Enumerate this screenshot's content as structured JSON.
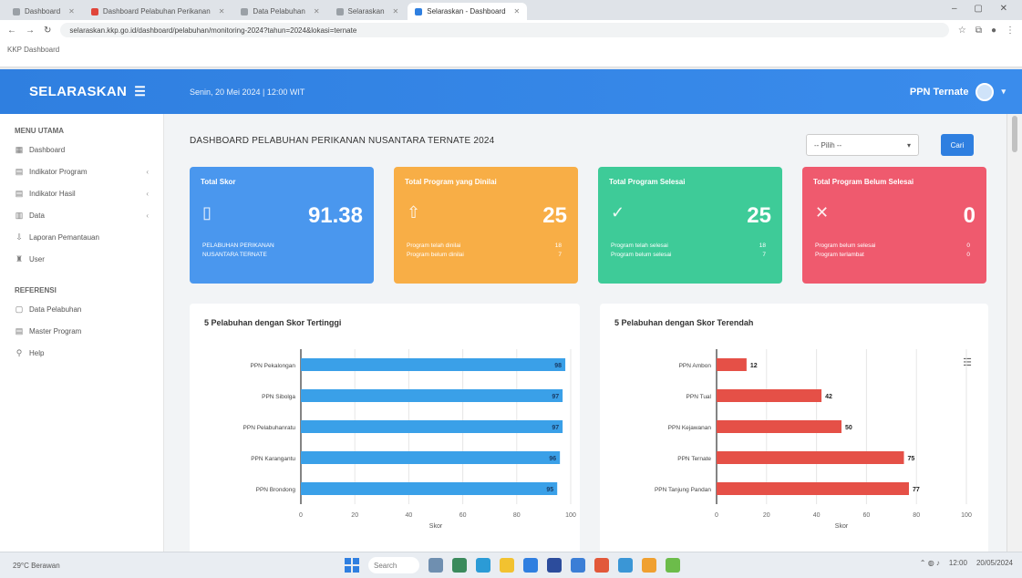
{
  "browser": {
    "tabs": [
      {
        "label": "Dashboard",
        "active": false
      },
      {
        "label": "Dashboard Pelabuhan Perikanan",
        "active": false
      },
      {
        "label": "Data Pelabuhan",
        "active": false
      },
      {
        "label": "Selaraskan",
        "active": false
      },
      {
        "label": "Selaraskan - Dashboard",
        "active": true
      }
    ],
    "url": "selaraskan.kkp.go.id/dashboard/pelabuhan/monitoring-2024?tahun=2024&lokasi=ternate",
    "bookmarks": "KKP   Dashboard"
  },
  "header": {
    "brand": "SELARASKAN",
    "info": "Senin, 20 Mei 2024  |  12:00 WIT",
    "user": "PPN Ternate"
  },
  "sidebar": {
    "section1": "MENU UTAMA",
    "items": [
      {
        "icon": "▦",
        "label": "Dashboard",
        "has_arrow": false
      },
      {
        "icon": "▤",
        "label": "Indikator Program",
        "has_arrow": true
      },
      {
        "icon": "▤",
        "label": "Indikator Hasil",
        "has_arrow": true
      },
      {
        "icon": "▥",
        "label": "Data",
        "has_arrow": true
      },
      {
        "icon": "⇩",
        "label": "Laporan Pemantauan",
        "has_arrow": false
      },
      {
        "icon": "♜",
        "label": "User",
        "has_arrow": false
      }
    ],
    "section2": "REFERENSI",
    "items2": [
      {
        "icon": "▢",
        "label": "Data Pelabuhan"
      },
      {
        "icon": "▤",
        "label": "Master Program"
      },
      {
        "icon": "⚲",
        "label": "Help"
      }
    ]
  },
  "dashboard": {
    "title": "DASHBOARD PELABUHAN PERIKANAN NUSANTARA TERNATE 2024",
    "year_select": "-- Pilih --",
    "filter_label": "Cari"
  },
  "cards": [
    {
      "title": "Total Skor",
      "icon": "▯",
      "value": "91.38",
      "sub1": "PELABUHAN PERIKANAN",
      "sub2": "NUSANTARA TERNATE",
      "sub1_val": "",
      "sub2_val": "",
      "color": "#4a97ee"
    },
    {
      "title": "Total Program yang Dinilai",
      "icon": "⇧",
      "value": "25",
      "sub1": "Program telah dinilai",
      "sub2": "Program belum dinilai",
      "sub1_val": "18",
      "sub2_val": "7",
      "color": "#f8ae46"
    },
    {
      "title": "Total Program Selesai",
      "icon": "✓",
      "value": "25",
      "sub1": "Program telah selesai",
      "sub2": "Program belum selesai",
      "sub1_val": "18",
      "sub2_val": "7",
      "color": "#3ecb98"
    },
    {
      "title": "Total Program Belum Selesai",
      "icon": "✕",
      "value": "0",
      "sub1": "Program belum selesai",
      "sub2": "Program terlambat",
      "sub1_val": "0",
      "sub2_val": "0",
      "color": "#ef5a6e"
    }
  ],
  "chart_data": [
    {
      "type": "bar",
      "orientation": "horizontal",
      "title": "5 Pelabuhan dengan Skor Tertinggi",
      "categories": [
        "PPN Pekalongan",
        "PPN Sibolga",
        "PPN Pelabuhanratu",
        "PPN Karangantu",
        "PPN Brondong"
      ],
      "values": [
        98,
        97,
        97,
        96,
        95
      ],
      "data_labels": [
        "98",
        "97",
        "97",
        "96",
        "95"
      ],
      "color": "#3aa0e8",
      "xlim": [
        0,
        100
      ],
      "xticks": [
        "0",
        "20",
        "40",
        "60",
        "80",
        "100"
      ],
      "xlabel": "Skor"
    },
    {
      "type": "bar",
      "orientation": "horizontal",
      "title": "5 Pelabuhan dengan Skor Terendah",
      "categories": [
        "PPN Ambon",
        "PPN Tual",
        "PPN Kejawanan",
        "PPN Ternate",
        "PPN Tanjung Pandan"
      ],
      "values": [
        12,
        42,
        50,
        75,
        77
      ],
      "data_labels": [
        "12",
        "42",
        "50",
        "75",
        "77"
      ],
      "color": "#e55047",
      "xlim": [
        0,
        100
      ],
      "xticks": [
        "0",
        "20",
        "40",
        "60",
        "80",
        "100"
      ],
      "xlabel": "Skor"
    }
  ],
  "taskbar": {
    "weather": "29°C  Berawan",
    "search": "Search",
    "time": "12:00",
    "date": "20/05/2024"
  }
}
